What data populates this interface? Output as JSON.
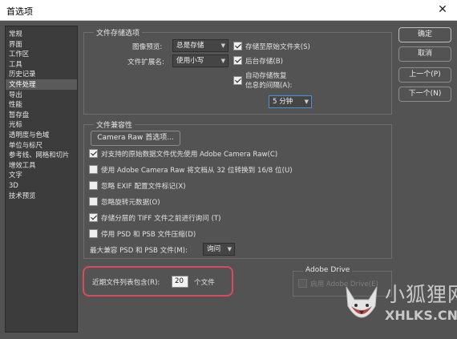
{
  "window": {
    "title": "首选项"
  },
  "sidebar": {
    "items": [
      {
        "label": "常规"
      },
      {
        "label": "界面"
      },
      {
        "label": "工作区"
      },
      {
        "label": "工具"
      },
      {
        "label": "历史记录"
      },
      {
        "label": "文件处理"
      },
      {
        "label": "导出"
      },
      {
        "label": "性能"
      },
      {
        "label": "暂存盘"
      },
      {
        "label": "光标"
      },
      {
        "label": "透明度与色域"
      },
      {
        "label": "单位与标尺"
      },
      {
        "label": "参考线、网格和切片"
      },
      {
        "label": "增效工具"
      },
      {
        "label": "文字"
      },
      {
        "label": "3D"
      },
      {
        "label": "技术预览"
      }
    ],
    "selected": "文件处理"
  },
  "file_save": {
    "title": "文件存储选项",
    "image_preview_label": "图像预览:",
    "image_preview_value": "总是存储",
    "extension_label": "文件扩展名:",
    "extension_value": "使用小写",
    "save_as_original": {
      "label": "存储至原始文件夹(S)",
      "checked": true
    },
    "background_save": {
      "label": "后台存储(B)",
      "checked": true
    },
    "auto_save": {
      "label_line1": "自动存储恢复",
      "label_line2": "信息的间隔(A):",
      "checked": true
    },
    "interval_value": "5 分钟"
  },
  "compatibility": {
    "title": "文件兼容性",
    "camera_raw_button": "Camera Raw 首选项...",
    "options": [
      {
        "label": "对支持的原始数据文件优先使用 Adobe Camera Raw(C)",
        "checked": true
      },
      {
        "label": "使用 Adobe Camera Raw 将文档从 32 位转换到 16/8 位(U)",
        "checked": false
      },
      {
        "label": "忽略 EXIF 配置文件标记(X)",
        "checked": false
      },
      {
        "label": "忽略旋转元数据(O)",
        "checked": false
      },
      {
        "label": "存储分层的 TIFF 文件之前进行询问 (T)",
        "checked": true
      },
      {
        "label": "停用 PSD 和 PSB 文件压缩(D)",
        "checked": false
      }
    ],
    "max_compat_label": "最大兼容 PSD 和 PSB 文件(M):",
    "max_compat_value": "询问"
  },
  "recent_files": {
    "label": "近期文件列表包含(R):",
    "value": "20",
    "unit": "个文件"
  },
  "adobe_drive": {
    "title": "Adobe Drive",
    "enable_label": "启用 Adobe Drive(E)",
    "checked": false
  },
  "buttons": {
    "ok": "确定",
    "cancel": "取消",
    "prev": "上一个(P)",
    "next": "下一个(N)"
  },
  "watermark": {
    "cn": "小狐狸网",
    "en": "XHLKS.CN"
  },
  "colors": {
    "highlight": "#d64c5a",
    "panel_bg": "#535353",
    "accent_focus": "#4e8fd8"
  }
}
